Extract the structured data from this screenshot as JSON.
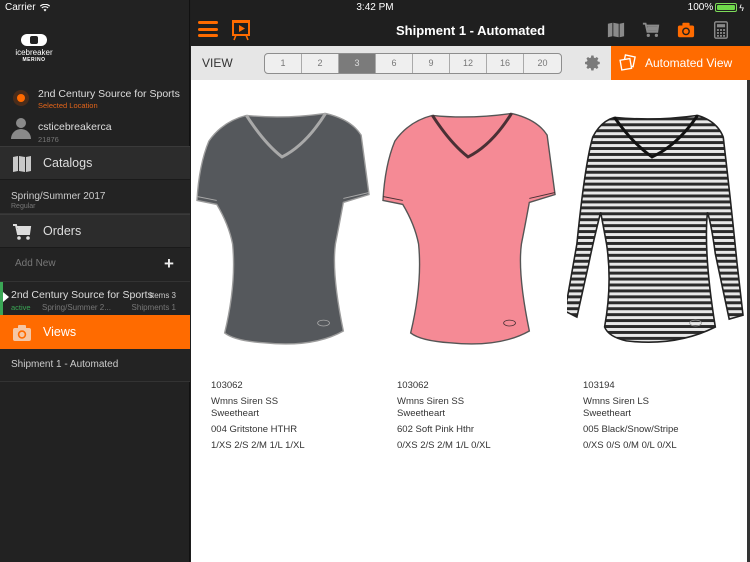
{
  "status_bar": {
    "carrier": "Carrier",
    "time": "3:42 PM",
    "battery": "100%",
    "battery_level": 1.0
  },
  "sidebar": {
    "logo": {
      "brand": "icebreaker",
      "sub": "MERINO"
    },
    "location": {
      "name": "2nd Century Source for Sports",
      "sublabel": "Selected Location"
    },
    "user": {
      "name": "csticebreakerca",
      "id": "21876"
    },
    "catalogs": {
      "label": "Catalogs",
      "items": [
        {
          "title": "Spring/Summer 2017",
          "subtitle": "Regular"
        }
      ]
    },
    "orders": {
      "label": "Orders",
      "add_new": "Add New",
      "items": [
        {
          "name": "2nd Century Source for Sports",
          "items": "Items 3",
          "status": "active",
          "season": "Spring/Summer 2...",
          "shipments": "Shipments 1"
        }
      ]
    },
    "views": {
      "label": "Views",
      "items": [
        {
          "title": "Shipment 1 - Automated"
        }
      ]
    }
  },
  "navbar": {
    "title": "Shipment 1 - Automated",
    "icons": [
      "menu-icon",
      "presentation-icon",
      "catalog-icon",
      "cart-icon",
      "camera-icon",
      "calculator-icon"
    ]
  },
  "toolbar": {
    "view_label": "VIEW",
    "view_options": [
      "1",
      "2",
      "3",
      "6",
      "9",
      "12",
      "16",
      "20"
    ],
    "selected_view": "3",
    "automated_view_label": "Automated View"
  },
  "products": [
    {
      "style": "103062",
      "name_line1": "Wmns Siren SS",
      "name_line2": "Sweetheart",
      "color": "004 Gritstone HTHR",
      "sizes": "1/XS 2/S 2/M 1/L 1/XL",
      "swatch": "#55585c",
      "trim": "#a9a9a9",
      "sleeve": "short"
    },
    {
      "style": "103062",
      "name_line1": "Wmns Siren SS",
      "name_line2": "Sweetheart",
      "color": "602 Soft Pink Hthr",
      "sizes": "0/XS 2/S 2/M 1/L 0/XL",
      "swatch": "#f58a95",
      "trim": "#4a3035",
      "sleeve": "short"
    },
    {
      "style": "103194",
      "name_line1": "Wmns Siren LS",
      "name_line2": "Sweetheart",
      "color": "005 Black/Snow/Stripe",
      "sizes": "0/XS 0/S 0/M 0/L 0/XL",
      "swatch": "stripe",
      "trim": "#111111",
      "sleeve": "long"
    }
  ],
  "colors": {
    "accent": "#ff6b00",
    "active_status": "#3aa655",
    "sidebar_bg": "#222222",
    "navbar_bg": "#1f1f1f"
  }
}
